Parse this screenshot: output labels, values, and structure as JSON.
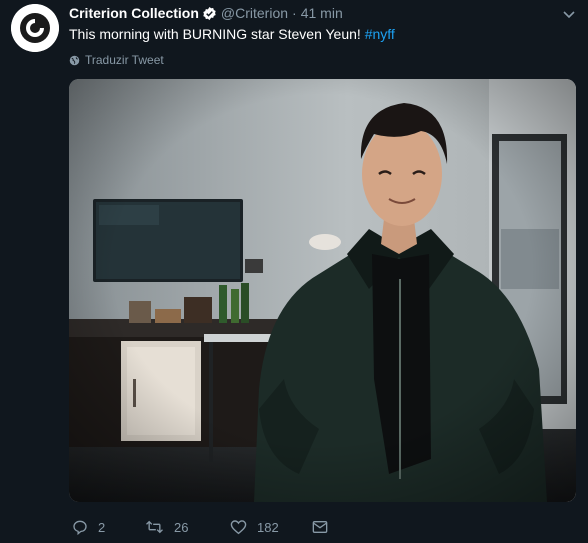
{
  "tweet": {
    "display_name": "Criterion Collection",
    "handle": "@Criterion",
    "separator": "·",
    "time": "41 min",
    "text_before_hashtag": "This morning with BURNING star Steven Yeun! ",
    "hashtag": "#nyff",
    "translate_label": "Traduzir Tweet"
  },
  "actions": {
    "reply_count": "2",
    "retweet_count": "26",
    "like_count": "182"
  },
  "colors": {
    "background": "#10171e",
    "secondary_text": "#8899a6",
    "link": "#1da1f2",
    "verified_badge": "#ffffff"
  },
  "icons": {
    "verified": "verified-badge-icon",
    "caret": "chevron-down-icon",
    "globe": "globe-icon",
    "reply": "reply-icon",
    "retweet": "retweet-icon",
    "like": "heart-icon",
    "message": "envelope-icon"
  }
}
